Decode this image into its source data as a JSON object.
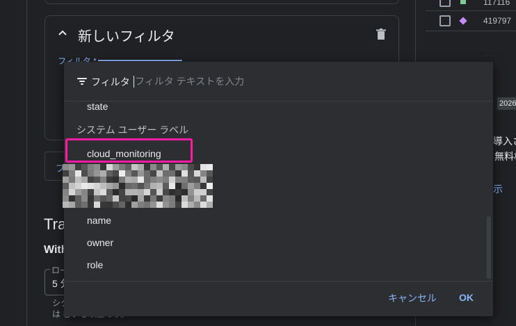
{
  "background": {
    "filter_card_title": "新しいフィルタ",
    "field_label": "フィルタ *",
    "left_button_text": "フ",
    "section_title_fragment": "Tra",
    "subsection_fragment": "With",
    "duration_label_fragment": "ロー",
    "duration_value_fragment": "5 分",
    "help_text_line1_fragment": "シク",
    "help_text_line2_fragment": "は むいる以上です。"
  },
  "right_panel": {
    "rows": [
      {
        "value": "117116",
        "legend": "square",
        "color": "#81c995"
      },
      {
        "value": "419797",
        "legend": "diamond",
        "color": "#c58af9"
      }
    ],
    "date_badge": "2026",
    "text_line1": "導入さ",
    "text_line2": "無料枚",
    "link_text": "示"
  },
  "dropdown": {
    "header_label": "フィルタ",
    "search_placeholder": "フィルタ テキストを入力",
    "options_top": [
      "state"
    ],
    "group_header": "システム ユーザー ラベル",
    "highlighted_option": "cloud_monitoring",
    "options_bottom": [
      "name",
      "owner",
      "role"
    ],
    "cancel_label": "キャンセル",
    "ok_label": "OK"
  },
  "colors": {
    "accent": "#8ab4f8",
    "highlight_box": "#ff1aa5",
    "dialog_bg": "#2d2e31",
    "page_bg": "#202124"
  }
}
